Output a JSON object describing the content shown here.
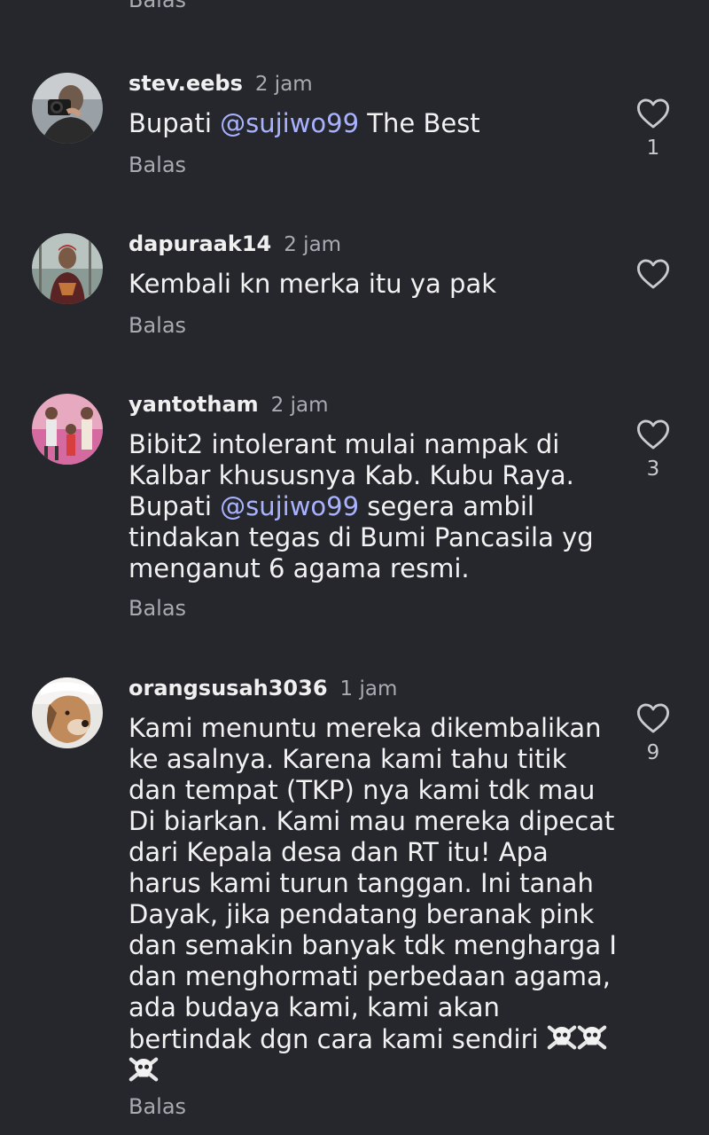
{
  "top_reply_label": "Balas",
  "comments": [
    {
      "username": "stev.eebs",
      "time": "2 jam",
      "text_parts": [
        "Bupati ",
        "@sujiwo99",
        "  The Best"
      ],
      "reply_label": "Balas",
      "like_count": "1",
      "avatar_icon": "camera-person-avatar"
    },
    {
      "username": "dapuraak14",
      "time": "2 jam",
      "text": "Kembali kn merka itu ya pak",
      "reply_label": "Balas",
      "like_count": "",
      "avatar_icon": "person-outdoors-avatar"
    },
    {
      "username": "yantotham",
      "time": "2 jam",
      "text_parts": [
        "Bibit2 intolerant mulai nampak di Kalbar khususnya Kab. Kubu Raya. Bupati ",
        "@sujiwo99",
        " segera ambil tindakan tegas di Bumi Pancasila yg menganut 6 agama resmi."
      ],
      "reply_label": "Balas",
      "like_count": "3",
      "avatar_icon": "family-photo-avatar"
    },
    {
      "username": "orangsusah3036",
      "time": "1 jam",
      "text": "Kami menuntu mereka dikembalikan ke asalnya. Karena kami tahu titik dan tempat (TKP) nya kami tdk mau Di biarkan. Kami mau mereka dipecat dari Kepala desa dan RT itu! Apa harus kami turun tanggan. Ini tanah Dayak, jika pendatang beranak pink dan semakin banyak tdk mengharga I dan menghormati perbedaan agama, ada budaya kami, kami akan bertindak dgn cara kami sendiri",
      "emoji": "☠️☠️☠️",
      "reply_label": "Balas",
      "like_count": "9",
      "avatar_icon": "dog-avatar"
    }
  ],
  "colors": {
    "background": "#25272c",
    "mention": "#a8b2ff",
    "secondary_text": "#a8abb2"
  }
}
